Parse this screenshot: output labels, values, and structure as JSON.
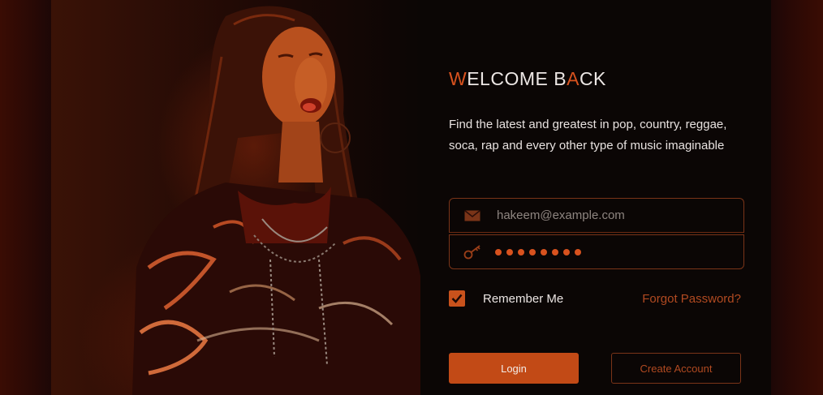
{
  "welcome": {
    "title_parts": [
      "W",
      "ELCOME B",
      "A",
      "CK"
    ],
    "description": "Find the latest and greatest in pop, country, reggae, soca, rap and every other type of music imaginable"
  },
  "form": {
    "email_placeholder": "hakeem@example.com",
    "password_masked_length": 8,
    "remember_label": "Remember Me",
    "remember_checked": true,
    "forgot_label": "Forgot Password?",
    "login_label": "Login",
    "create_label": "Create Account"
  },
  "icons": {
    "email": "envelope-icon",
    "password": "key-icon",
    "check": "checkmark-icon"
  },
  "colors": {
    "accent": "#c24a16",
    "accent_text": "#d8521e",
    "background": "#0b0605"
  }
}
